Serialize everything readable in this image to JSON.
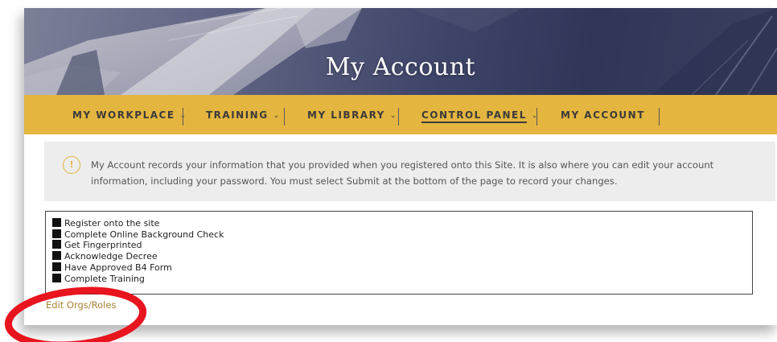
{
  "hero": {
    "title": "My Account"
  },
  "nav": {
    "items": [
      {
        "label": "MY WORKPLACE",
        "chevron": "⌵",
        "has_dropdown": true,
        "active": false
      },
      {
        "label": "TRAINING",
        "has_dropdown": true,
        "active": false
      },
      {
        "label": "MY LIBRARY",
        "has_dropdown": true,
        "active": false
      },
      {
        "label": "CONTROL PANEL",
        "has_dropdown": true,
        "active": true
      },
      {
        "label": "MY ACCOUNT",
        "has_dropdown": false,
        "active": false
      }
    ],
    "chevron_glyph": "⌄"
  },
  "notice": {
    "icon": "!",
    "text": "My Account records your information that you provided when you registered onto this Site. It is also where you can edit your account information, including your password. You must select Submit at the bottom of the page to record your changes."
  },
  "checklist": {
    "items": [
      {
        "label": "Register onto the site",
        "checked": true
      },
      {
        "label": "Complete Online Background Check",
        "checked": true
      },
      {
        "label": "Get Fingerprinted",
        "checked": true
      },
      {
        "label": "Acknowledge Decree",
        "checked": true
      },
      {
        "label": "Have Approved B4 Form",
        "checked": true
      },
      {
        "label": "Complete Training",
        "checked": true
      }
    ]
  },
  "links": {
    "edit_orgs_roles": "Edit Orgs/Roles"
  },
  "colors": {
    "nav_bg": "#e4b53f",
    "link": "#a88236",
    "annotation": "#e8141e",
    "notice_bg": "#ededed"
  }
}
